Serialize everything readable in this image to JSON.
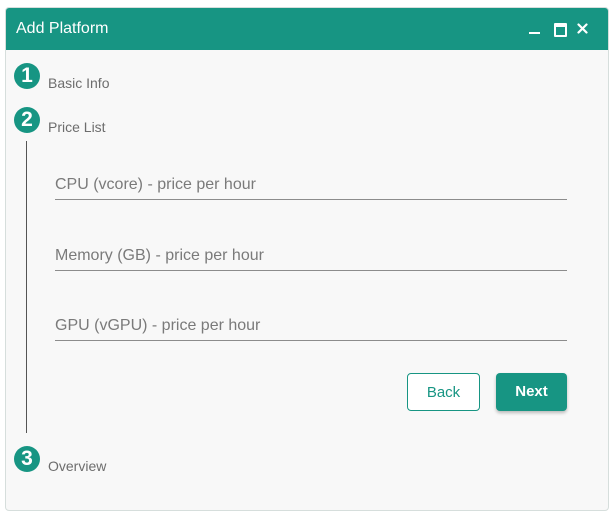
{
  "window": {
    "title": "Add Platform",
    "controls": [
      {
        "icon": "minimize-icon"
      },
      {
        "icon": "maximize-icon"
      },
      {
        "icon": "close-icon",
        "glyph": "×"
      }
    ]
  },
  "stepper": {
    "steps": [
      {
        "number": "1",
        "label": "Basic Info"
      },
      {
        "number": "2",
        "label": "Price List"
      },
      {
        "number": "3",
        "label": "Overview"
      }
    ]
  },
  "form": {
    "fields": [
      {
        "placeholder": "CPU (vcore) - price per hour",
        "value": ""
      },
      {
        "placeholder": "Memory (GB) - price per hour",
        "value": ""
      },
      {
        "placeholder": "GPU (vGPU) - price per hour",
        "value": ""
      }
    ],
    "back_label": "Back",
    "next_label": "Next"
  },
  "colors": {
    "accent": "#179583",
    "background": "#f8f8f8",
    "label": "#6d6d6d"
  }
}
